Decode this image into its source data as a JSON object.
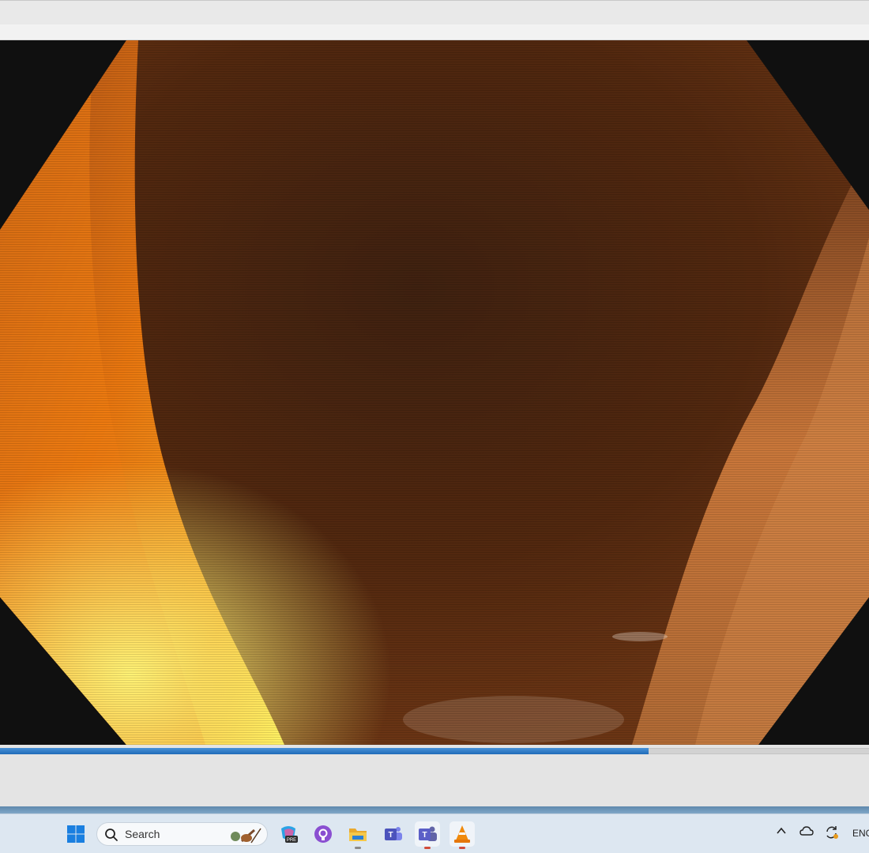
{
  "player": {
    "progress_fraction": 0.746
  },
  "taskbar": {
    "search_placeholder": "Search",
    "apps": [
      {
        "name": "Start",
        "icon": "windows-logo-icon"
      },
      {
        "name": "Search",
        "icon": "search-icon"
      },
      {
        "name": "Copilot PRE",
        "icon": "copilot-pre-icon",
        "badge": "PRE"
      },
      {
        "name": "GitHub",
        "icon": "github-icon"
      },
      {
        "name": "File Explorer",
        "icon": "folder-icon"
      },
      {
        "name": "Teams",
        "icon": "teams-icon"
      },
      {
        "name": "Teams (active)",
        "icon": "teams-new-icon"
      },
      {
        "name": "VLC media player",
        "icon": "vlc-cone-icon"
      }
    ],
    "tray": {
      "language": "ENG",
      "icons": [
        "chevron-up-icon",
        "onedrive-cloud-icon",
        "sync-icon"
      ]
    }
  },
  "colors": {
    "progress": "#2f7bc6",
    "taskbar_bg": "#dde7f1",
    "video_border": "#101010"
  }
}
